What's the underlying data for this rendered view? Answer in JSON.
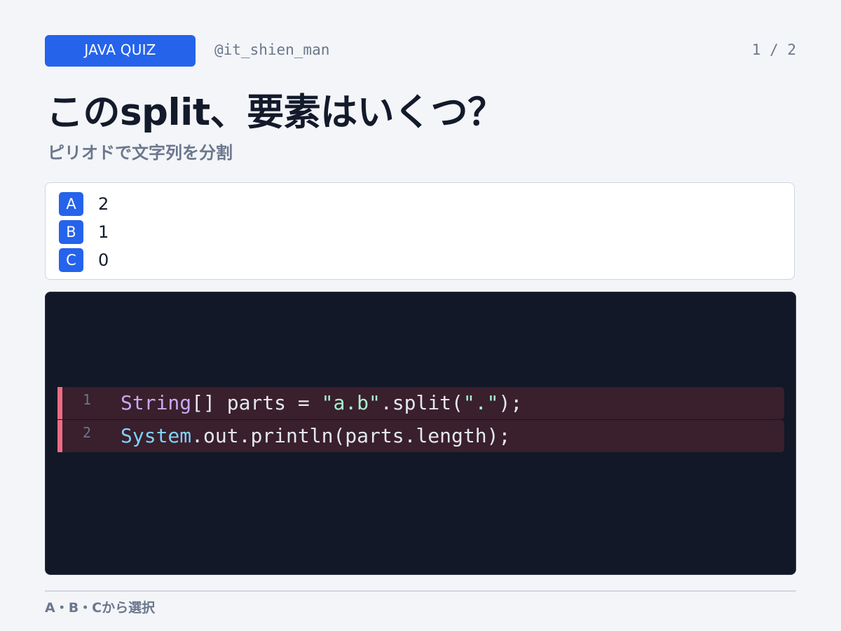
{
  "header": {
    "badge": "JAVA QUIZ",
    "handle": "@it_shien_man",
    "page_count": "1 / 2"
  },
  "question": {
    "title": "このsplit、要素はいくつ？",
    "subtitle": "ピリオドで文字列を分割"
  },
  "options": [
    {
      "letter": "A",
      "text": "2"
    },
    {
      "letter": "B",
      "text": "1"
    },
    {
      "letter": "C",
      "text": "0"
    }
  ],
  "code": {
    "lines": [
      {
        "number": "1",
        "tokens": [
          {
            "text": "String",
            "kind": "type"
          },
          {
            "text": "[] parts = ",
            "kind": "plain"
          },
          {
            "text": "\"a.b\"",
            "kind": "str"
          },
          {
            "text": ".split(",
            "kind": "plain"
          },
          {
            "text": "\".\"",
            "kind": "str"
          },
          {
            "text": ");",
            "kind": "plain"
          }
        ]
      },
      {
        "number": "2",
        "tokens": [
          {
            "text": "System",
            "kind": "class"
          },
          {
            "text": ".out.println(parts.length);",
            "kind": "plain"
          }
        ]
      }
    ]
  },
  "footer": {
    "text": "A・B・Cから選択"
  },
  "colors": {
    "accent": "#2563eb",
    "background": "#f3f5f8",
    "code_background": "#121828",
    "highlight_line": "#3a1f2c",
    "highlight_bar": "#ec6c85"
  }
}
